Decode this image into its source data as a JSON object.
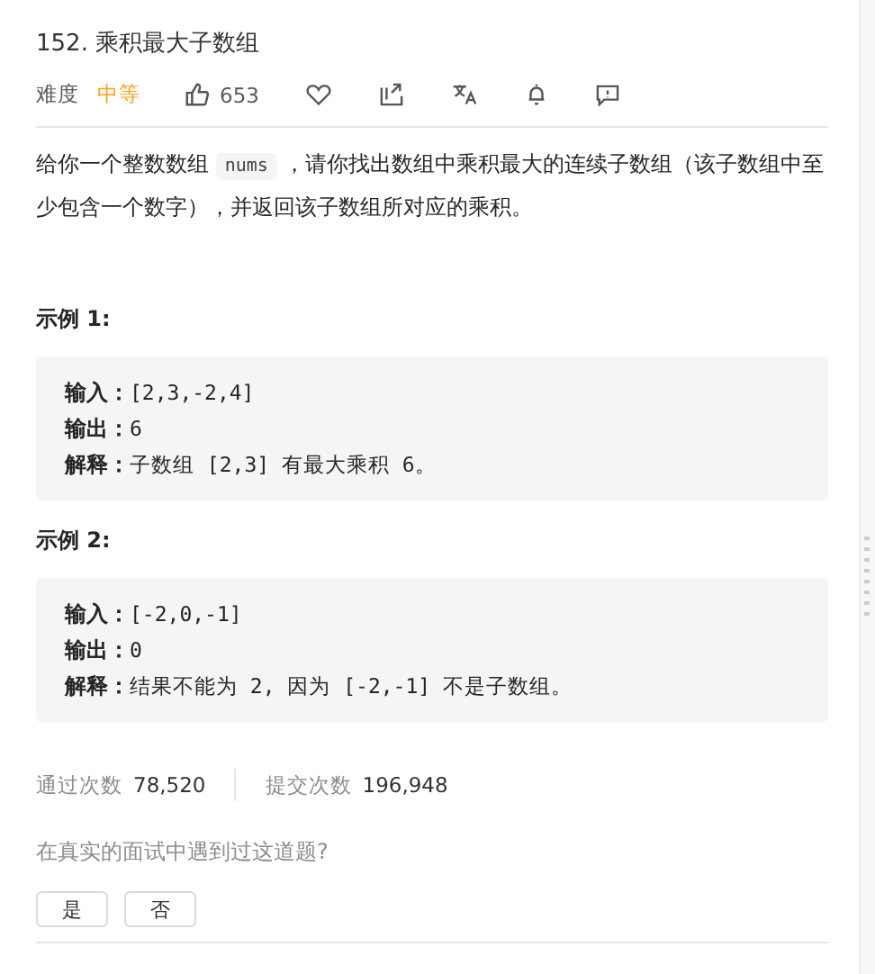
{
  "title": "152. 乘积最大子数组",
  "meta": {
    "difficulty_label": "难度",
    "difficulty": "中等",
    "likes": "653"
  },
  "description": {
    "before": "给你一个整数数组 ",
    "code": "nums",
    "after": " ，请你找出数组中乘积最大的连续子数组（该子数组中至少包含一个数字），并返回该子数组所对应的乘积。"
  },
  "examples": [
    {
      "heading": "示例 1:",
      "lines": [
        {
          "label": "输入：",
          "value": "[2,3,-2,4]"
        },
        {
          "label": "输出：",
          "value": "6"
        },
        {
          "label": "解释：",
          "value": "子数组 [2,3] 有最大乘积 6。"
        }
      ]
    },
    {
      "heading": "示例 2:",
      "lines": [
        {
          "label": "输入：",
          "value": "[-2,0,-1]"
        },
        {
          "label": "输出：",
          "value": "0"
        },
        {
          "label": "解释：",
          "value": "结果不能为 2, 因为 [-2,-1] 不是子数组。"
        }
      ]
    }
  ],
  "stats": [
    {
      "label": "通过次数",
      "value": "78,520"
    },
    {
      "label": "提交次数",
      "value": "196,948"
    }
  ],
  "question": "在真实的面试中遇到过这道题?",
  "answers": [
    "是",
    "否"
  ]
}
